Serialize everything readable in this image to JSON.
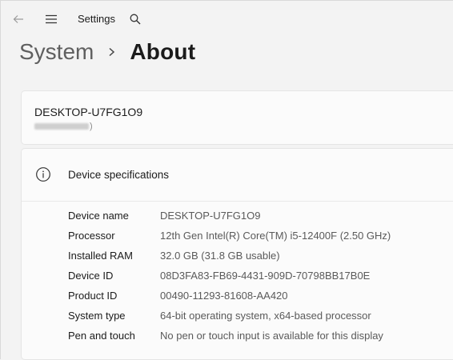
{
  "titlebar": {
    "back_icon": "back-arrow-icon",
    "menu_icon": "hamburger-menu-icon",
    "app_title": "Settings",
    "search_icon": "search-icon"
  },
  "breadcrumb": {
    "parent": "System",
    "separator_icon": "chevron-right-icon",
    "current": "About"
  },
  "device": {
    "name": "DESKTOP-U7FG1O9",
    "model_suffix": ")"
  },
  "specs": {
    "icon": "info-icon",
    "title": "Device specifications",
    "rows": [
      {
        "label": "Device name",
        "value": "DESKTOP-U7FG1O9"
      },
      {
        "label": "Processor",
        "value": "12th Gen Intel(R) Core(TM) i5-12400F (2.50 GHz)"
      },
      {
        "label": "Installed RAM",
        "value": "32.0 GB (31.8 GB usable)"
      },
      {
        "label": "Device ID",
        "value": "08D3FA83-FB69-4431-909D-70798BB17B0E"
      },
      {
        "label": "Product ID",
        "value": "00490-11293-81608-AA420"
      },
      {
        "label": "System type",
        "value": "64-bit operating system, x64-based processor"
      },
      {
        "label": "Pen and touch",
        "value": "No pen or touch input is available for this display"
      }
    ]
  },
  "colors": {
    "background": "#f3f3f3",
    "card": "#fbfbfb",
    "text_primary": "#1b1b1b",
    "text_secondary": "#5a5a5a"
  }
}
